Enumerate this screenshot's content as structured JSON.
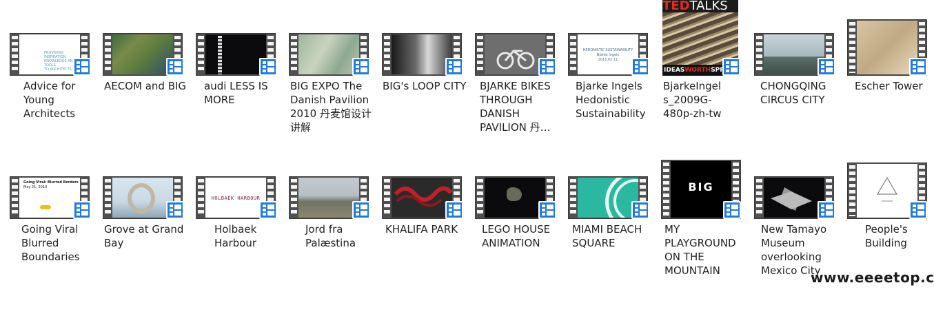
{
  "items": [
    {
      "label": "Advice for Young Architects",
      "thumb_text": [
        "PROVIDING INSPIRATION",
        "KNOWLEDGE AND TOOLS",
        "TO ARCHITECTS"
      ]
    },
    {
      "label": "AECOM and BIG"
    },
    {
      "label": "audi  LESS IS MORE"
    },
    {
      "label": "BIG EXPO The Danish Pavilion 2010 丹麦馆设计讲解"
    },
    {
      "label": "BIG's LOOP CITY"
    },
    {
      "label": "BJARKE BIKES THROUGH DANISH PAVILION 丹…"
    },
    {
      "label": "Bjarke Ingels Hedonistic Sustainability",
      "thumb_text": [
        "HEDONISTIC SUSTAINABILITY",
        "Bjarke Ingels",
        "2011.02.11"
      ]
    },
    {
      "label": "BjarkeIngels_2009G-480p-zh-tw",
      "thumb_text": [
        "TED",
        "TALKS",
        "IDEAS",
        "WORTH",
        "SPREADING"
      ]
    },
    {
      "label": "CHONGQING CIRCUS CITY"
    },
    {
      "label": "Escher Tower"
    },
    {
      "label": "Going Viral Blurred Boundaries",
      "thumb_text": [
        "Going Viral: Blurred Borders",
        "May 21, 2010"
      ]
    },
    {
      "label": "Grove at Grand Bay"
    },
    {
      "label": "Holbaek Harbour",
      "thumb_text": [
        "HOLBAEK HARBOUR"
      ]
    },
    {
      "label": "Jord fra Palæstina"
    },
    {
      "label": "KHALIFA PARK"
    },
    {
      "label": "LEGO HOUSE ANIMATION"
    },
    {
      "label": "MIAMI BEACH SQUARE"
    },
    {
      "label": "MY PLAYGROUND ON THE MOUNTAIN",
      "thumb_text": [
        "BIG"
      ]
    },
    {
      "label": "New Tamayo Museum overlooking Mexico City"
    },
    {
      "label": "People's Building"
    }
  ],
  "watermark": "www.eeeetop.com"
}
